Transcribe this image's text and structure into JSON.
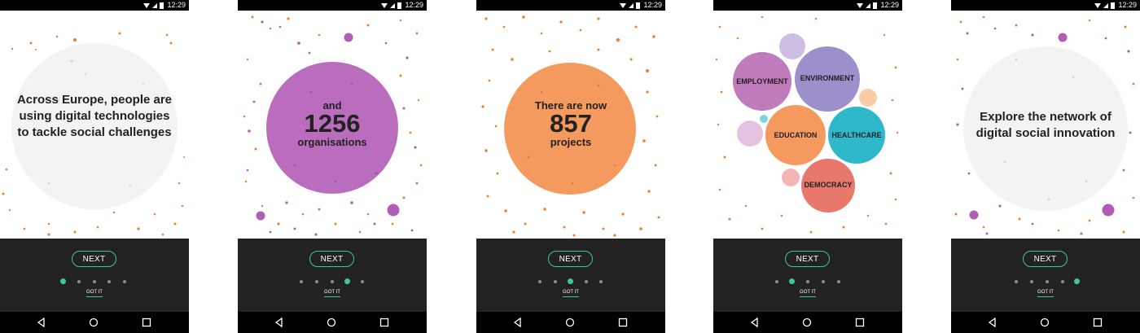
{
  "status": {
    "time": "12:29"
  },
  "colors": {
    "orange": "#f07d2e",
    "purple": "#b15db5",
    "accent": "#3dc7a0",
    "panel": "#222222"
  },
  "icons": {
    "wifi": "wifi-icon",
    "signal": "signal-icon",
    "battery": "battery-icon",
    "back": "back-icon",
    "home": "home-icon",
    "recents": "recents-icon"
  },
  "screens": [
    {
      "text_lines": [
        "Across Europe, people are",
        "using digital technologies",
        "to tackle social challenges"
      ],
      "active_dot": 0
    },
    {
      "small_top": "and",
      "number": "1256",
      "small_bottom": "organisations",
      "active_dot": 3
    },
    {
      "small_top": "There are now",
      "number": "857",
      "small_bottom": "projects",
      "active_dot": 2
    },
    {
      "topics": [
        "EMPLOYMENT",
        "ENVIRONMENT",
        "EDUCATION",
        "HEALTHCARE",
        "DEMOCRACY"
      ],
      "active_dot": 1
    },
    {
      "text_lines": [
        "Explore the network of",
        "digital social innovation"
      ],
      "active_dot": 4
    }
  ],
  "footer": {
    "next_label": "NEXT",
    "gotit_label": "GOT IT"
  }
}
